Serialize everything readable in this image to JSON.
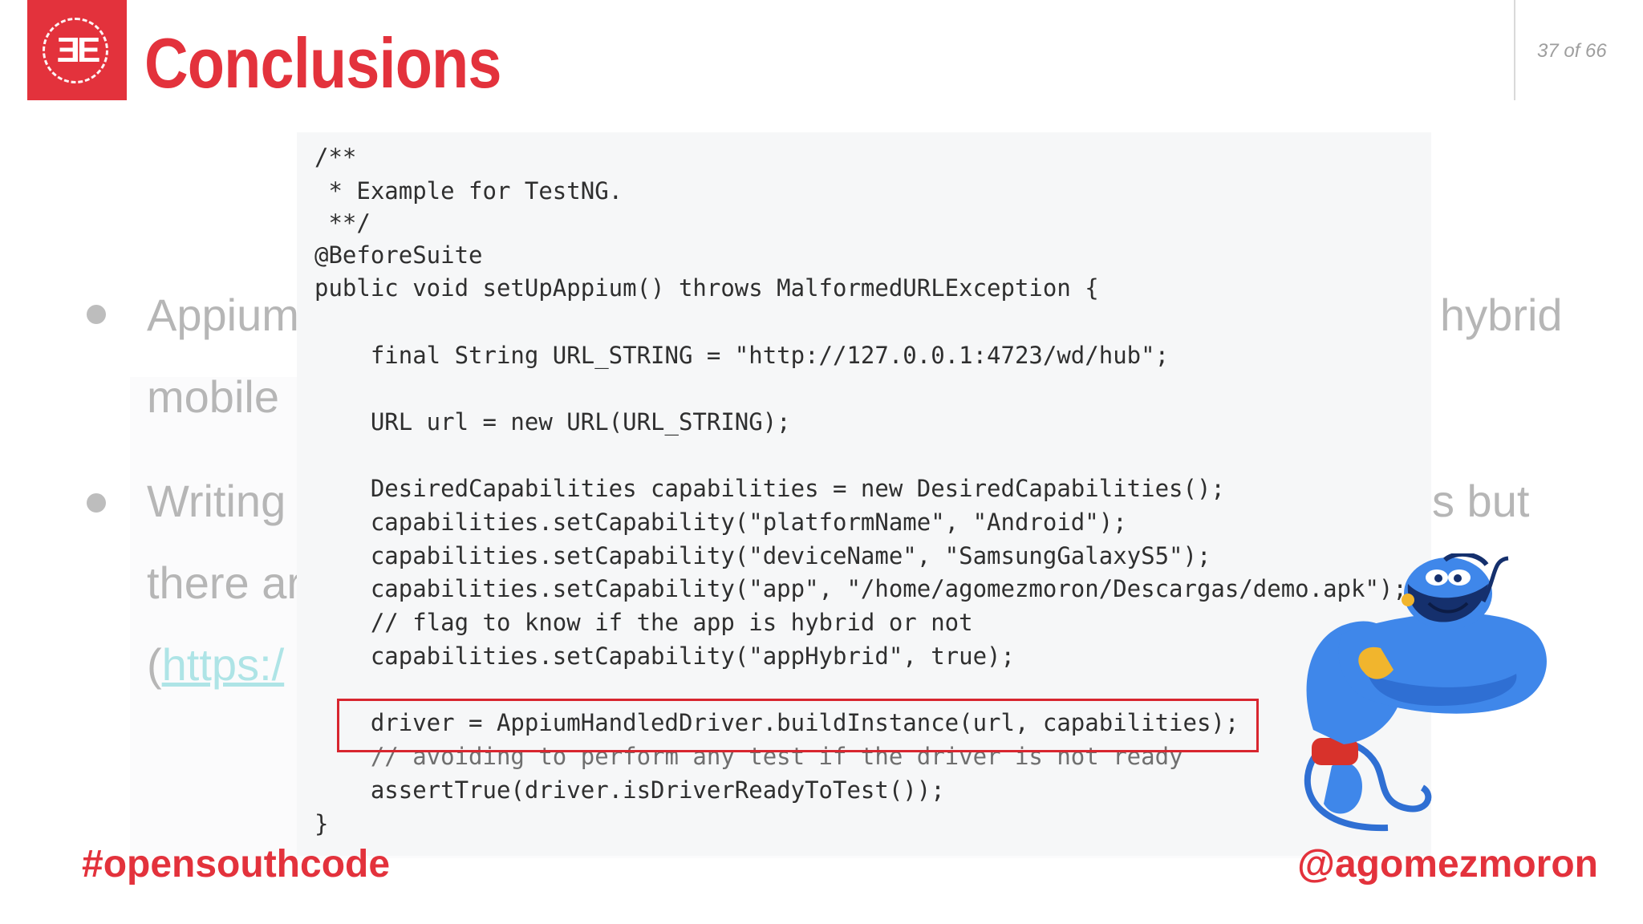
{
  "header": {
    "logo_text": "ƎE",
    "title": "Conclusions",
    "page_indicator": "37 of 66"
  },
  "background_bullets": {
    "line1_left": "Appium",
    "line1_right": "hybrid",
    "line2_left": "mobile",
    "line3_left": "Writing",
    "line3_right": "s but",
    "line4_left": "there ar",
    "line5_paren": "(",
    "line5_link": "https:/"
  },
  "code": {
    "lines": [
      "/**",
      " * Example for TestNG.",
      " **/",
      "@BeforeSuite",
      "public void setUpAppium() throws MalformedURLException {",
      "    final String URL_STRING = \"http://127.0.0.1:4723/wd/hub\";",
      "    URL url = new URL(URL_STRING);",
      "    DesiredCapabilities capabilities = new DesiredCapabilities();",
      "    capabilities.setCapability(\"platformName\", \"Android\");",
      "    capabilities.setCapability(\"deviceName\", \"SamsungGalaxyS5\");",
      "    capabilities.setCapability(\"app\", \"/home/agomezmoron/Descargas/demo.apk\");",
      "    // flag to know if the app is hybrid or not",
      "    capabilities.setCapability(\"appHybrid\", true);",
      "    driver = AppiumHandledDriver.buildInstance(url, capabilities);",
      "    // avoiding to perform any test if the driver is not ready",
      "    assertTrue(driver.isDriverReadyToTest());",
      "}"
    ]
  },
  "footer": {
    "hashtag": "#opensouthcode",
    "handle": "@agomezmoron"
  },
  "colors": {
    "brand_red": "#e3323c",
    "highlight_red": "#d8262f",
    "faded_text": "#b6b6b6",
    "link": "#aee4e6"
  }
}
